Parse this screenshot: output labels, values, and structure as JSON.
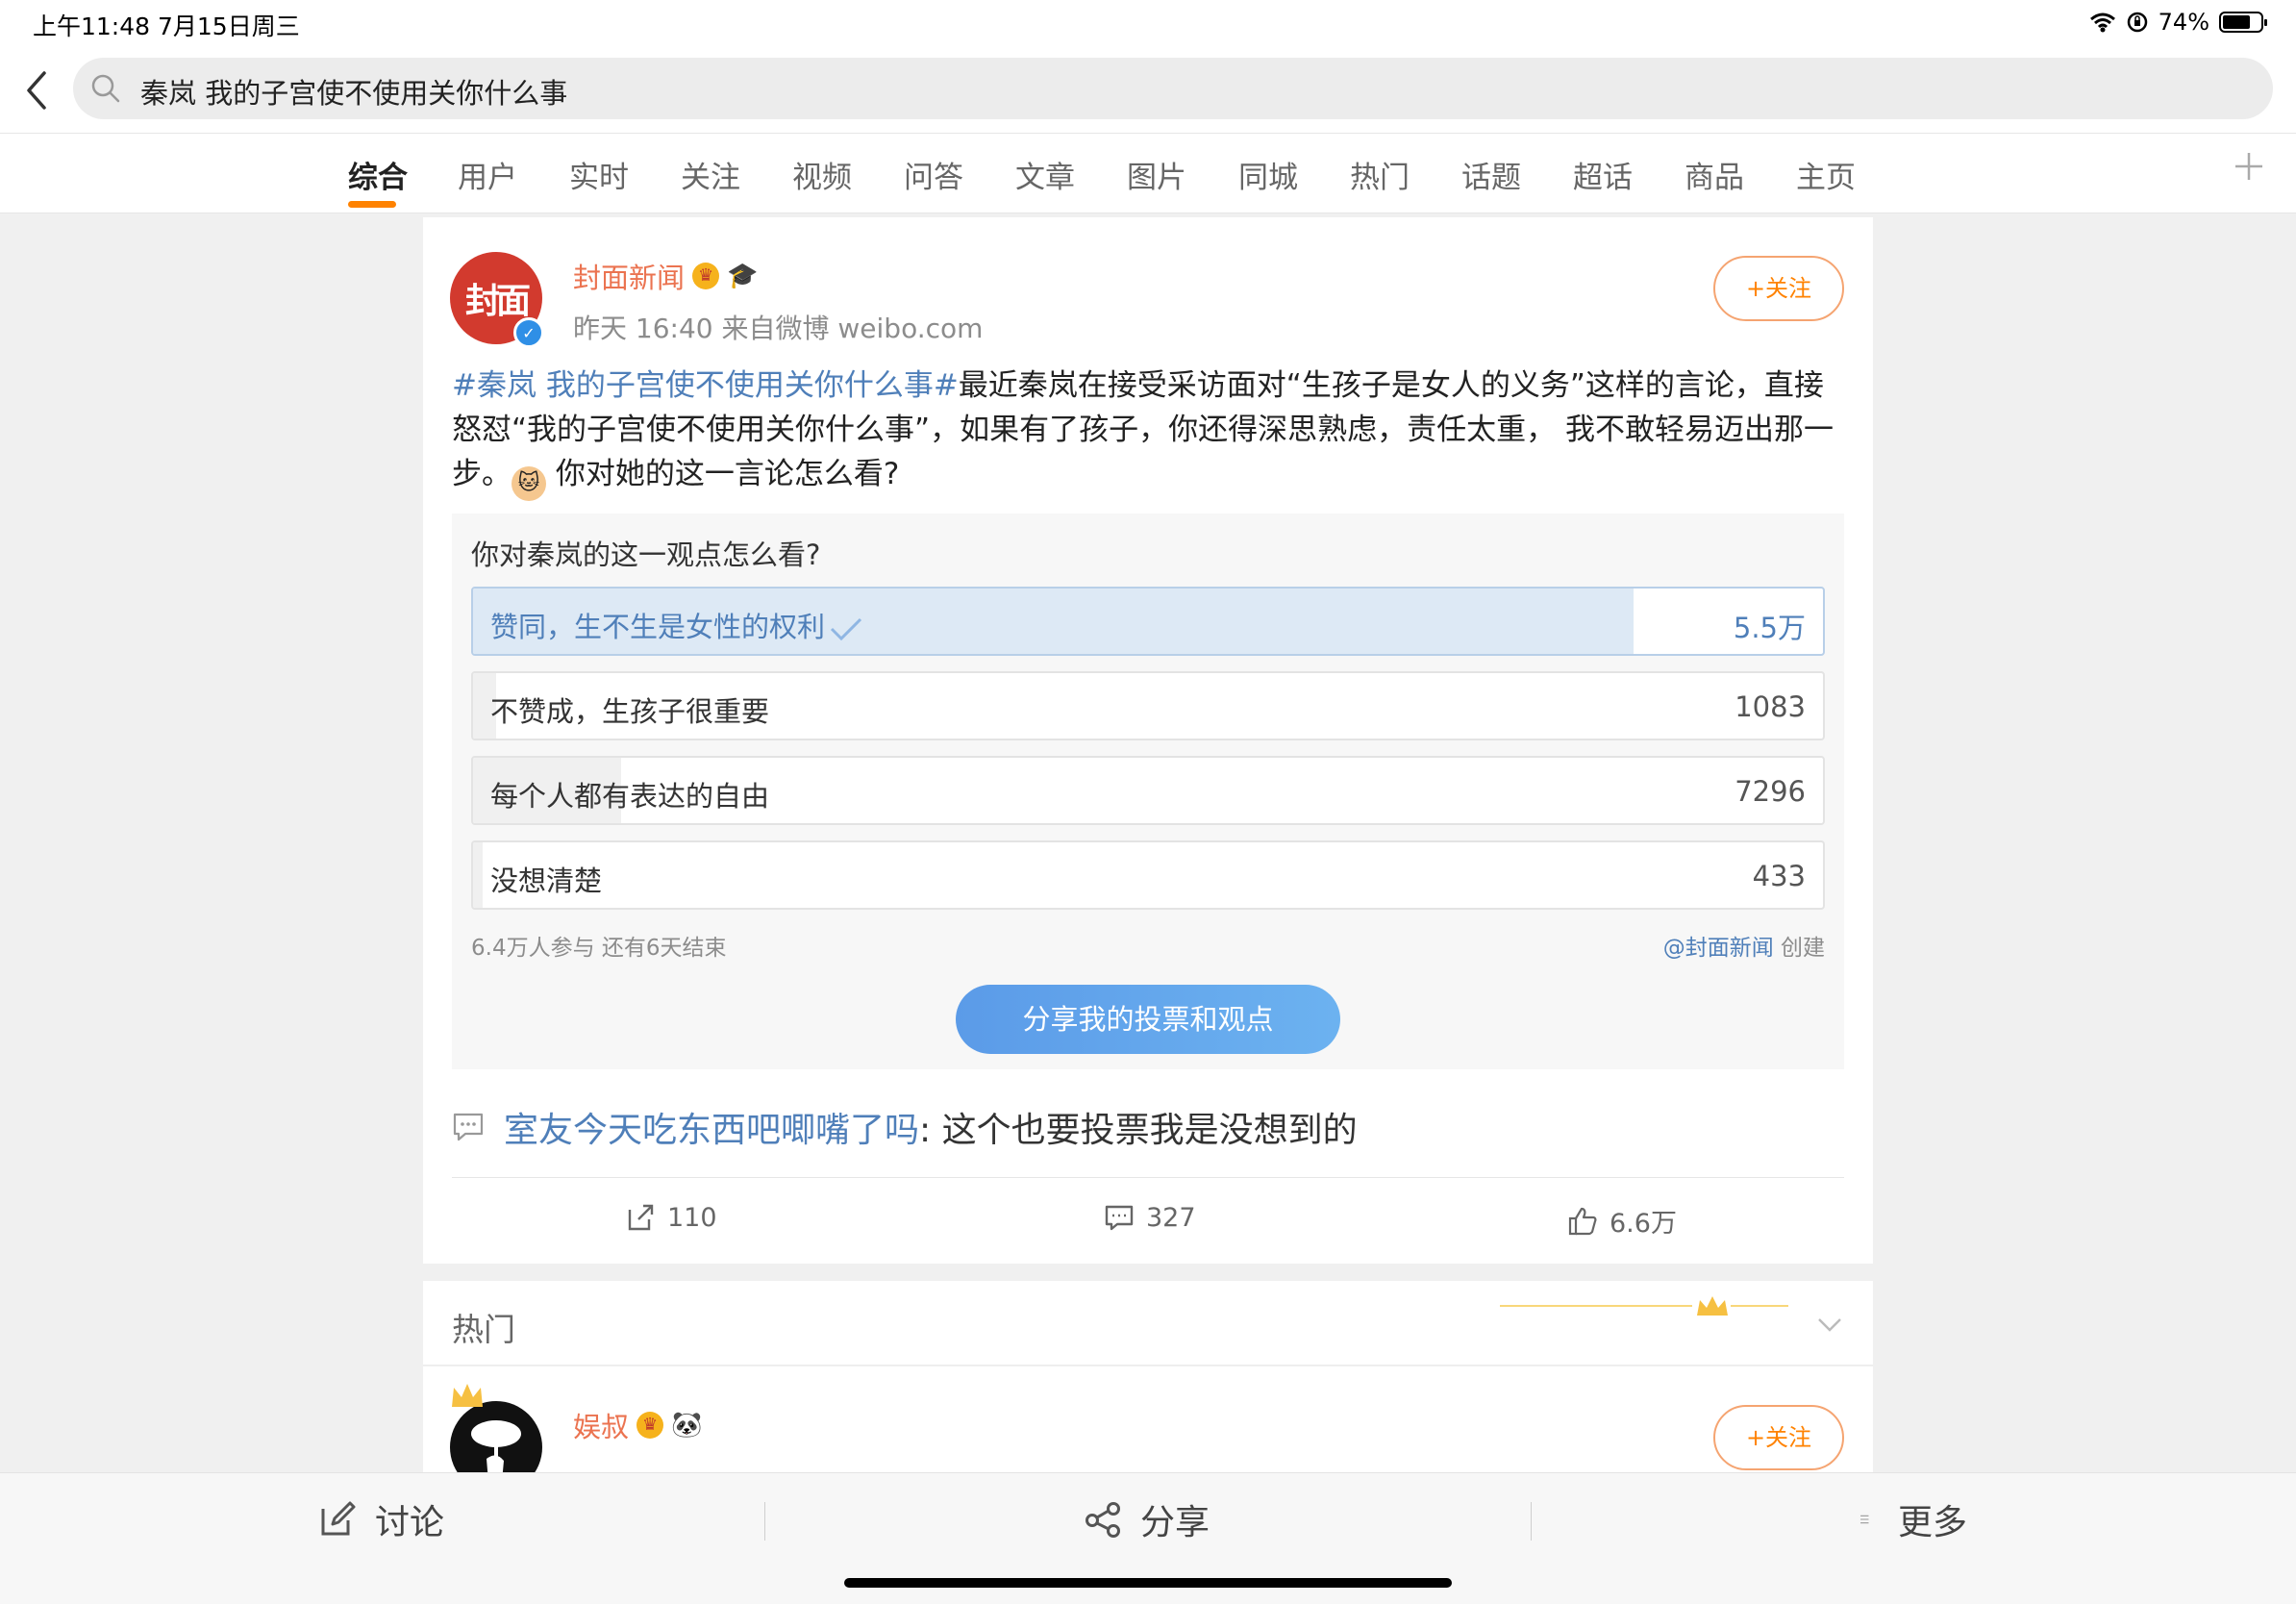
{
  "status": {
    "time": "上午11:48   7月15日周三",
    "battery": "74%",
    "battery_level": 0.74
  },
  "search": {
    "query": "秦岚 我的子宫使不使用关你什么事"
  },
  "tabs": [
    "综合",
    "用户",
    "实时",
    "关注",
    "视频",
    "问答",
    "文章",
    "图片",
    "同城",
    "热门",
    "话题",
    "超话",
    "商品",
    "主页"
  ],
  "post": {
    "avatar_text": "封面",
    "author": "封面新闻",
    "meta": "昨天 16:40  来自微博 weibo.com",
    "follow_label": "+关注",
    "topic": "#秦岚 我的子宫使不使用关你什么事#",
    "text_main": "最近秦岚在接受采访面对“生孩子是女人的义务”这样的言论，直接怒怼“我的子宫使不使用关你什么事”，如果有了孩子，你还得深思熟虑，责任太重， 我不敢轻易迈出那一步。",
    "text_tail": " 你对她的这一言论怎么看?",
    "poll": {
      "question": "你对秦岚的这一观点怎么看?",
      "options": [
        {
          "label": "赞同，生不生是女性的权利",
          "count": "5.5万",
          "share": 0.86,
          "selected": true
        },
        {
          "label": "不赞成，生孩子很重要",
          "count": "1083",
          "share": 0.017,
          "selected": false
        },
        {
          "label": "每个人都有表达的自由",
          "count": "7296",
          "share": 0.11,
          "selected": false
        },
        {
          "label": "没想清楚",
          "count": "433",
          "share": 0.007,
          "selected": false
        }
      ],
      "participants": "6.4万人参与   还有6天结束",
      "creator": "@封面新闻",
      "created_label": " 创建",
      "share_button": "分享我的投票和观点"
    },
    "comment": {
      "user": "室友今天吃东西吧唧嘴了吗",
      "text": ": 这个也要投票我是没想到的"
    },
    "actions": {
      "repost": "110",
      "comments": "327",
      "likes": "6.6万"
    }
  },
  "hot": {
    "title": "热门"
  },
  "post2": {
    "author": "娱叔",
    "follow_label": "+关注"
  },
  "bottom": {
    "discuss": "讨论",
    "share": "分享",
    "more": "更多"
  }
}
